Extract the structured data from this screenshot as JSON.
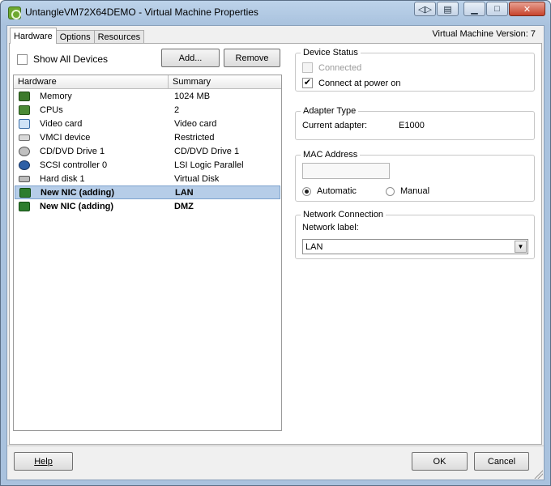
{
  "window": {
    "title": "UntangleVM72X64DEMO - Virtual Machine Properties",
    "app_icon": "vsphere-vm-icon",
    "controls": [
      "remote-console-icon",
      "snapshot-icon",
      "minimize-icon",
      "maximize-icon",
      "close-icon"
    ]
  },
  "tabs": [
    {
      "label": "Hardware",
      "active": true
    },
    {
      "label": "Options",
      "active": false
    },
    {
      "label": "Resources",
      "active": false
    }
  ],
  "vm_version": "Virtual Machine Version: 7",
  "toolbar": {
    "show_all_label": "Show All Devices",
    "show_all_checked": false,
    "add_label": "Add...",
    "remove_label": "Remove"
  },
  "devices": {
    "headers": {
      "hardware": "Hardware",
      "summary": "Summary"
    },
    "rows": [
      {
        "name": "Memory",
        "summary": "1024 MB",
        "icon": "memory-icon"
      },
      {
        "name": "CPUs",
        "summary": "2",
        "icon": "cpu-icon"
      },
      {
        "name": "Video card",
        "summary": "Video card",
        "icon": "video-card-icon"
      },
      {
        "name": "VMCI device",
        "summary": "Restricted",
        "icon": "vmci-device-icon"
      },
      {
        "name": "CD/DVD Drive 1",
        "summary": "CD/DVD Drive 1",
        "icon": "cd-dvd-icon"
      },
      {
        "name": "SCSI controller 0",
        "summary": "LSI Logic Parallel",
        "icon": "scsi-controller-icon"
      },
      {
        "name": "Hard disk 1",
        "summary": "Virtual Disk",
        "icon": "hard-disk-icon"
      },
      {
        "name": "New NIC (adding)",
        "summary": "LAN",
        "icon": "network-adapter-icon",
        "selected": true,
        "bold": true
      },
      {
        "name": "New NIC (adding)",
        "summary": "DMZ",
        "icon": "network-adapter-icon",
        "selected": false,
        "bold": true
      }
    ]
  },
  "device_status": {
    "legend": "Device Status",
    "connected_label": "Connected",
    "connected_checked": false,
    "connected_enabled": false,
    "power_on_label": "Connect at power on",
    "power_on_checked": true
  },
  "adapter_type": {
    "legend": "Adapter Type",
    "label": "Current adapter:",
    "value": "E1000"
  },
  "mac_address": {
    "legend": "MAC Address",
    "value": "",
    "automatic_label": "Automatic",
    "manual_label": "Manual",
    "selected": "automatic"
  },
  "network_connection": {
    "legend": "Network Connection",
    "label": "Network label:",
    "value": "LAN"
  },
  "footer": {
    "help_label": "Help",
    "ok_label": "OK",
    "cancel_label": "Cancel"
  }
}
